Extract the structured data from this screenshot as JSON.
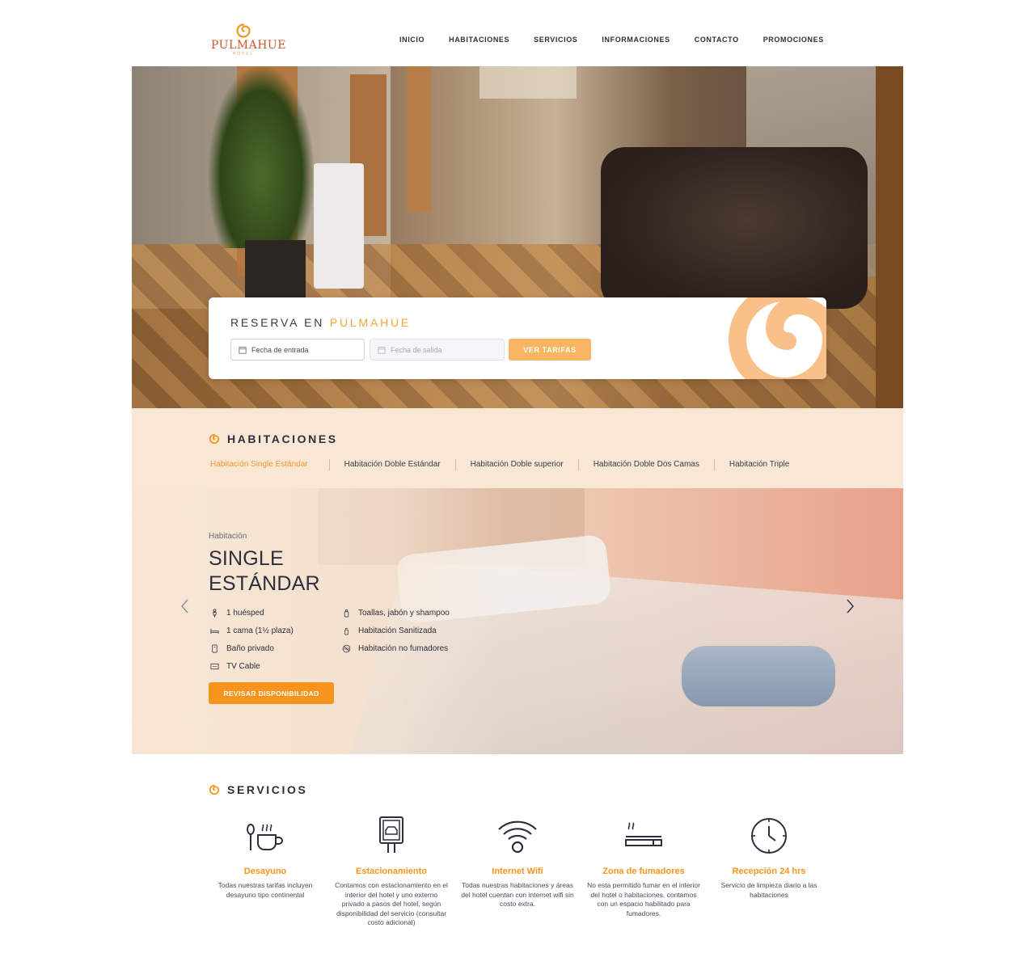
{
  "header": {
    "logo_name": "PULMAHUE",
    "logo_sub": "HOTEL",
    "nav": [
      "INICIO",
      "HABITACIONES",
      "SERVICIOS",
      "INFORMACIONES",
      "CONTACTO",
      "PROMOCIONES"
    ]
  },
  "booking": {
    "title_prefix": "RESERVA EN ",
    "title_accent": "PULMAHUE",
    "checkin_label": "Fecha de entrada",
    "checkout_label": "Fecha de salida",
    "rates_button": "VER TARIFAS"
  },
  "rooms": {
    "title": "HABITACIONES",
    "tabs": [
      "Habitación Single Estándar",
      "Habitación Doble Estándar",
      "Habitación Doble superior",
      "Habitación Doble Dos Camas",
      "Habitación Triple"
    ],
    "active_tab": 0,
    "kicker": "Habitación",
    "name_line1": "SINGLE",
    "name_line2": "ESTÁNDAR",
    "amenities_col1": [
      {
        "icon": "person-icon",
        "label": "1 huésped"
      },
      {
        "icon": "bed-icon",
        "label": "1 cama (1½ plaza)"
      },
      {
        "icon": "bathroom-icon",
        "label": "Baño privado"
      },
      {
        "icon": "tv-icon",
        "label": "TV Cable"
      }
    ],
    "amenities_col2": [
      {
        "icon": "toiletries-icon",
        "label": "Toallas, jabón y shampoo"
      },
      {
        "icon": "sanitizer-icon",
        "label": "Habitación Sanitizada"
      },
      {
        "icon": "no-smoking-icon",
        "label": "Habitación no fumadores"
      }
    ],
    "availability_button": "REVISAR DISPONIBILIDAD"
  },
  "services": {
    "title": "SERVICIOS",
    "items": [
      {
        "icon": "breakfast-icon",
        "name": "Desayuno",
        "desc": "Todas nuestras tarifas incluyen desayuno tipo continental"
      },
      {
        "icon": "parking-icon",
        "name": "Estacionamiento",
        "desc": "Contamos con estacionamiento en el interior del hotel y uno externo privado a pasos del hotel, según disponibilidad del servicio (consultar costo adicional)"
      },
      {
        "icon": "wifi-icon",
        "name": "Internet Wifi",
        "desc": "Todas nuestras habitaciones y áreas del hotel cuentan con internet wifi sin costo extra."
      },
      {
        "icon": "smoking-area-icon",
        "name": "Zona de fumadores",
        "desc": "No esta permitido fumar en el interior del hotel o habitaciones, contamos con un espacio habilitado para fumadores."
      },
      {
        "icon": "clock-icon",
        "name": "Recepción 24 hrs",
        "desc": "Servicio de limpieza diario a las habitaciones"
      }
    ]
  },
  "colors": {
    "accent": "#f7941d",
    "accent_light": "#f9b561",
    "logo_red": "#d0562e",
    "section_bg": "#f8e7d5",
    "text_dark": "#2e2e3e"
  }
}
